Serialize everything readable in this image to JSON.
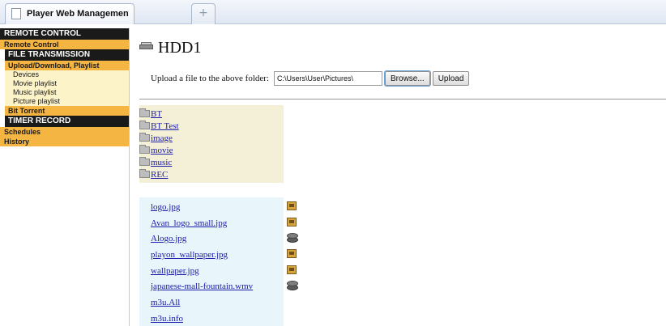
{
  "browser": {
    "tab_title": "Player Web Management",
    "new_tab_glyph": "+"
  },
  "sidebar": {
    "remote_control_header": "REMOTE CONTROL",
    "remote_control_item": "Remote Control",
    "file_transmission_header": "FILE TRANSMISSION",
    "upload_download_item": "Upload/Download, Playlist",
    "sub_items": [
      "Devices",
      "Movie playlist",
      "Music playlist",
      "Picture playlist"
    ],
    "bit_torrent_item": "Bit Torrent",
    "timer_record_header": "TIMER RECORD",
    "schedules_item": "Schedules",
    "history_item": "History"
  },
  "main": {
    "title": "HDD1",
    "title_icon": "hdd-icon",
    "upload_label": "Upload a file to the above folder:",
    "upload_path_value": "C:\\Users\\User\\Pictures\\",
    "browse_label": "Browse...",
    "upload_button_label": "Upload",
    "folders": [
      "BT",
      "BT Test",
      "image",
      "movie",
      "music",
      "REC"
    ],
    "files": [
      {
        "name": "logo.jpg",
        "icon": "photo-icon"
      },
      {
        "name": "Avan_logo_small.jpg",
        "icon": "photo-icon"
      },
      {
        "name": "Alogo.jpg",
        "icon": "disc-icon"
      },
      {
        "name": "playon_wallpaper.jpg",
        "icon": "photo-icon"
      },
      {
        "name": "wallpaper.jpg",
        "icon": "photo-icon"
      },
      {
        "name": "japanese-mall-fountain.wmv",
        "icon": "disc-icon"
      },
      {
        "name": "m3u.All",
        "icon": ""
      },
      {
        "name": "m3u.info",
        "icon": ""
      }
    ]
  },
  "colors": {
    "nav_header_bg": "#1a1a1a",
    "nav_orange": "#f4b542",
    "nav_sub_bg": "#fdf3c9",
    "folder_panel_bg": "#f3f0d7",
    "file_panel_bg": "#e8f5fb",
    "link": "#1a1aa8"
  }
}
